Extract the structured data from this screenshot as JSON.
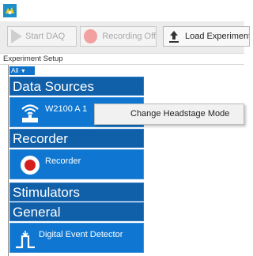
{
  "toolbar": {
    "start_daq_label": "Start DAQ",
    "recording_label": "Recording Off",
    "load_label": "Load Experiment"
  },
  "setup": {
    "header": "Experiment Setup",
    "filter_label": "All"
  },
  "sections": {
    "data_sources": "Data Sources",
    "recorder": "Recorder",
    "stimulators": "Stimulators",
    "general": "General"
  },
  "items": {
    "headstage": "W2100  A  1",
    "recorder": "Recorder",
    "digital_event": "Digital Event Detector"
  },
  "context_menu": {
    "change_headstage_mode": "Change Headstage Mode"
  },
  "colors": {
    "section_bg": "#0f5fa9",
    "item_bg": "#0f77d2",
    "record_red": "#d41f1f"
  }
}
